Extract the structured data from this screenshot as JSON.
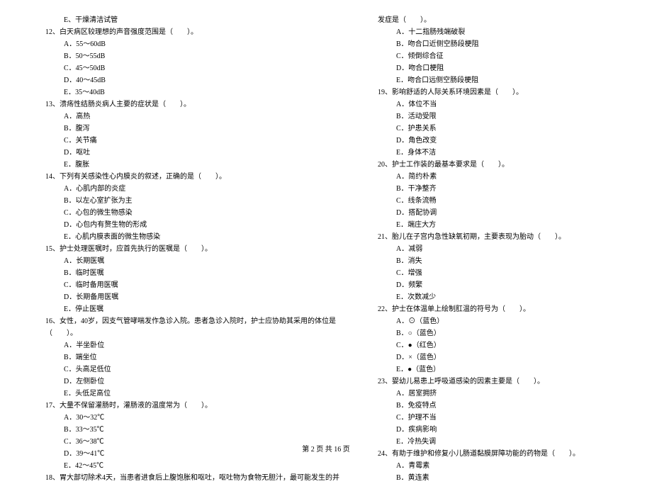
{
  "leftColumn": {
    "q11_e": "E、干燥清洁试管",
    "q12": {
      "stem": "12、白天病区较理想的声音强度范围是（　　）。",
      "a": "A．55～60dB",
      "b": "B．50～55dB",
      "c": "C．45～50dB",
      "d": "D．40～45dB",
      "e": "E．35～40dB"
    },
    "q13": {
      "stem": "13、溃疡性结肠炎病人主要的症状是（　　）。",
      "a": "A．高热",
      "b": "B．腹泻",
      "c": "C．关节痛",
      "d": "D．呕吐",
      "e": "E．腹胀"
    },
    "q14": {
      "stem": "14、下列有关感染性心内膜炎的叙述，正确的是（　　）。",
      "a": "A．心肌内部的炎症",
      "b": "B．以左心室扩张为主",
      "c": "C．心包的微生物感染",
      "d": "D．心包内有赘生物的形成",
      "e": "E．心肌内膜表面的微生物感染"
    },
    "q15": {
      "stem": "15、护士处理医嘱时，应首先执行的医嘱是（　　）。",
      "a": "A．长期医嘱",
      "b": "B．临时医嘱",
      "c": "C．临时备用医嘱",
      "d": "D．长期备用医嘱",
      "e": "E．停止医嘱"
    },
    "q16": {
      "stem": "16、女性，40岁，因支气管哮喘发作急诊入院。患者急诊入院时，护士应协助其采用的体位是",
      "cont": "（　　）。",
      "a": "A．半坐卧位",
      "b": "B．端坐位",
      "c": "C．头高足低位",
      "d": "D．左侧卧位",
      "e": "E．头低足高位"
    },
    "q17": {
      "stem": "17、大量不保留灌肠时，灌肠液的温度常为（　　）。",
      "a": "A．30～32℃",
      "b": "B．33～35℃",
      "c": "C．36～38℃",
      "d": "D．39～41℃",
      "e": "E．42～45℃"
    },
    "q18": {
      "stem": "18、胃大部切除术4天，当患者进食后上腹饱胀和呕吐，呕吐物为食物无胆汁，最可能发生的并"
    }
  },
  "rightColumn": {
    "q18_cont": "发症是（　　）。",
    "q18_opts": {
      "a": "A．十二指肠残端破裂",
      "b": "B．吻合口近侧空肠段梗阻",
      "c": "C．倾倒综合征",
      "d": "D．吻合口梗阻",
      "e": "E．吻合口远侧空肠段梗阻"
    },
    "q19": {
      "stem": "19、影响舒适的人际关系环境因素是（　　）。",
      "a": "A．体位不当",
      "b": "B．活动受限",
      "c": "C．护患关系",
      "d": "D．角色改变",
      "e": "E．身体不洁"
    },
    "q20": {
      "stem": "20、护士工作装的最基本要求是（　　）。",
      "a": "A．简约朴素",
      "b": "B．干净整齐",
      "c": "C．线条流畅",
      "d": "D．搭配协调",
      "e": "E．端庄大方"
    },
    "q21": {
      "stem": "21、胎儿在子宫内急性缺氧初期，主要表现为胎动（　　）。",
      "a": "A．减弱",
      "b": "B．消失",
      "c": "C．增强",
      "d": "D．频繁",
      "e": "E．次数减少"
    },
    "q22": {
      "stem": "22、护士在体温单上绘制肛温的符号为（　　）。",
      "a": "A．⊙（蓝色）",
      "b": "B．○（蓝色）",
      "c": "C．●（红色）",
      "d": "D．×（蓝色）",
      "e": "E．●（蓝色）"
    },
    "q23": {
      "stem": "23、婴幼儿易患上呼吸道感染的因素主要是（　　）。",
      "a": "A．居室拥挤",
      "b": "B．免疫特点",
      "c": "C．护理不当",
      "d": "D．疾病影响",
      "e": "E．冷热失调"
    },
    "q24": {
      "stem": "24、有助于维护和修复小儿肠道黏膜屏障功能的药物是（　　）。",
      "a": "A．青霉素",
      "b": "B．黄连素"
    }
  },
  "footer": "第 2 页 共 16 页"
}
